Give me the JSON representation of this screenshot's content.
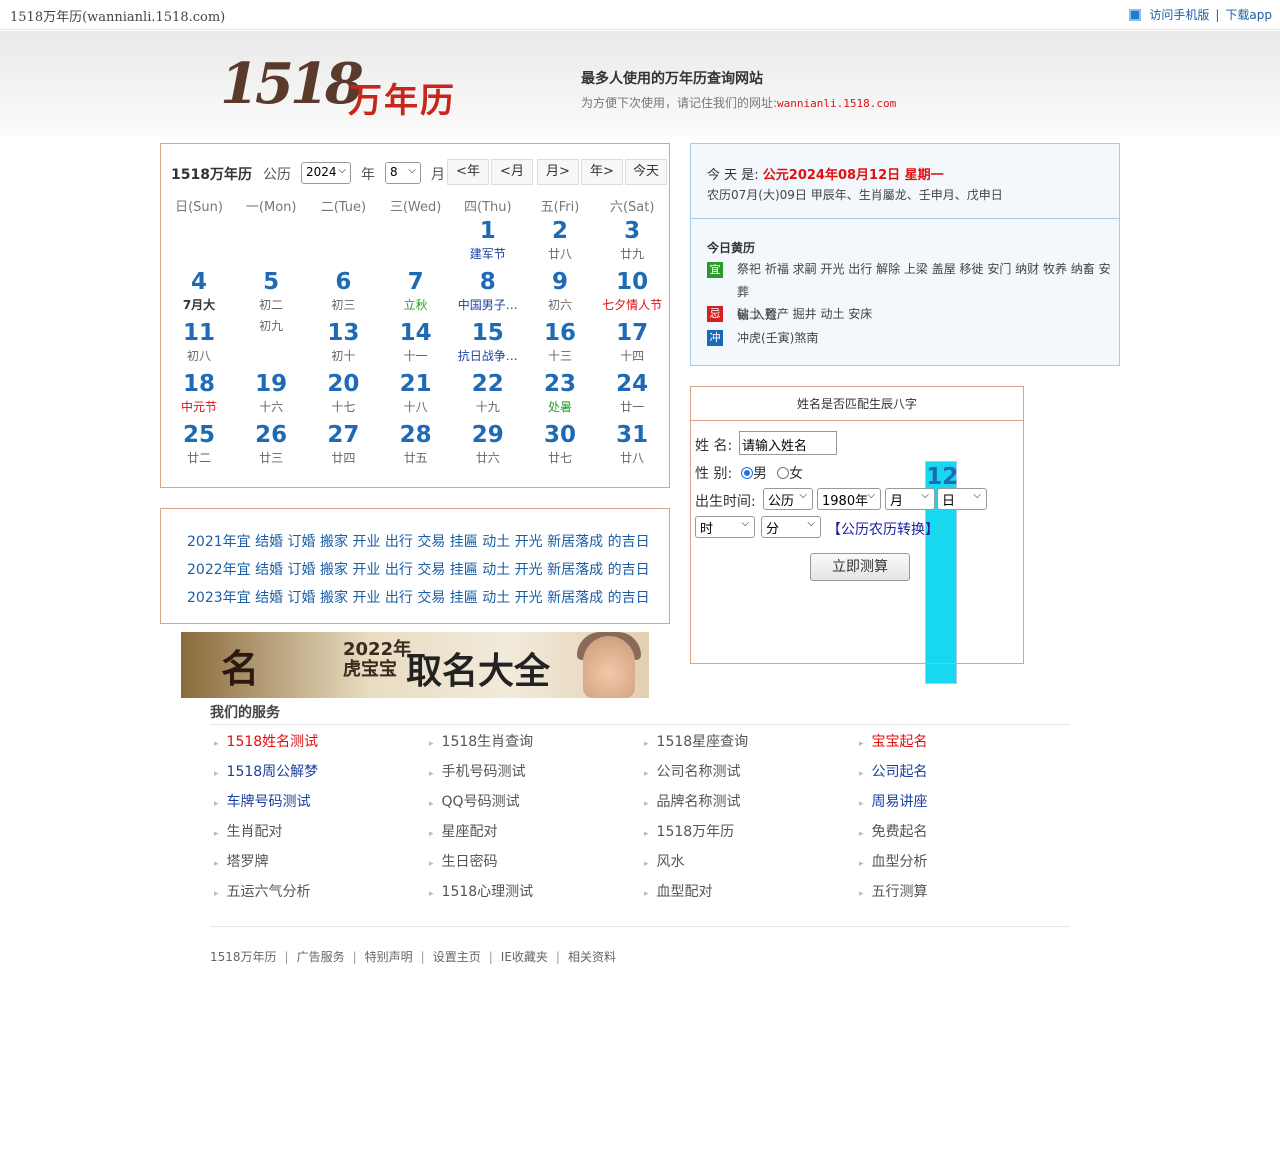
{
  "topbar": {
    "site": "1518万年历(wannianli.1518.com)",
    "mobile": "访问手机版",
    "sep": "|",
    "app": "下载app"
  },
  "header": {
    "logo_num": "1518",
    "logo_cn": "万年历",
    "slogan": "最多人使用的万年历查询网站",
    "tip": "为方便下次使用，请记住我们的网址:",
    "url": "wannianli.1518.com"
  },
  "calendar": {
    "brand": "1518万年历",
    "gongli": "公历",
    "year": "2024",
    "year_unit": "年",
    "month": "8",
    "month_unit": "月",
    "buttons": [
      "<年",
      "<月",
      "月>",
      "年>",
      "今天"
    ],
    "weekdays": [
      "日(Sun)",
      "一(Mon)",
      "二(Tue)",
      "三(Wed)",
      "四(Thu)",
      "五(Fri)",
      "六(Sat)"
    ],
    "days": [
      {
        "d": "1",
        "l": "建军节",
        "c": "blue"
      },
      {
        "d": "2",
        "l": "廿八",
        "c": ""
      },
      {
        "d": "3",
        "l": "廿九",
        "c": ""
      },
      {
        "d": "4",
        "l": "7月大",
        "c": "dark"
      },
      {
        "d": "5",
        "l": "初二",
        "c": ""
      },
      {
        "d": "6",
        "l": "初三",
        "c": ""
      },
      {
        "d": "7",
        "l": "立秋",
        "c": "green"
      },
      {
        "d": "8",
        "l": "中国男子…",
        "c": "blue"
      },
      {
        "d": "9",
        "l": "初六",
        "c": ""
      },
      {
        "d": "10",
        "l": "七夕情人节",
        "c": "red"
      },
      {
        "d": "11",
        "l": "初八",
        "c": ""
      },
      {
        "d": "12",
        "l": "初九",
        "c": "",
        "today": true
      },
      {
        "d": "13",
        "l": "初十",
        "c": ""
      },
      {
        "d": "14",
        "l": "十一",
        "c": ""
      },
      {
        "d": "15",
        "l": "抗日战争…",
        "c": "blue"
      },
      {
        "d": "16",
        "l": "十三",
        "c": ""
      },
      {
        "d": "17",
        "l": "十四",
        "c": ""
      },
      {
        "d": "18",
        "l": "中元节",
        "c": "red"
      },
      {
        "d": "19",
        "l": "十六",
        "c": ""
      },
      {
        "d": "20",
        "l": "十七",
        "c": ""
      },
      {
        "d": "21",
        "l": "十八",
        "c": ""
      },
      {
        "d": "22",
        "l": "十九",
        "c": ""
      },
      {
        "d": "23",
        "l": "处暑",
        "c": "green"
      },
      {
        "d": "24",
        "l": "廿一",
        "c": ""
      },
      {
        "d": "25",
        "l": "廿二",
        "c": ""
      },
      {
        "d": "26",
        "l": "廿三",
        "c": ""
      },
      {
        "d": "27",
        "l": "廿四",
        "c": ""
      },
      {
        "d": "28",
        "l": "廿五",
        "c": ""
      },
      {
        "d": "29",
        "l": "廿六",
        "c": ""
      },
      {
        "d": "30",
        "l": "廿七",
        "c": ""
      },
      {
        "d": "31",
        "l": "廿八",
        "c": ""
      }
    ]
  },
  "years": [
    "2021年宜 结婚 订婚 搬家 开业 出行 交易 挂匾 动土 开光 新居落成 的吉日",
    "2022年宜 结婚 订婚 搬家 开业 出行 交易 挂匾 动土 开光 新居落成 的吉日",
    "2023年宜 结婚 订婚 搬家 开业 出行 交易 挂匾 动土 开光 新居落成 的吉日"
  ],
  "banner": {
    "ming": "名",
    "year": "2022年",
    "sub": "虎宝宝",
    "big": "取名大全"
  },
  "today": {
    "label": "今 天 是: ",
    "date": "公元2024年08月12日 星期一",
    "lunar": "农历07月(大)09日 甲辰年、生肖屬龙、壬申月、戊申日",
    "title": "今日黄历",
    "yi_badge": "宜",
    "yi": "祭祀 祈福 求嗣 开光 出行 解除 上梁 盖屋 移徙 安门 纳财 牧养 纳畜 安葬",
    "yi2": "钻 入殓",
    "ji_badge": "忌",
    "ji": "破土 置产 掘井 动土 安床",
    "chong_badge": "冲",
    "chong": "冲虎(壬寅)煞南"
  },
  "form": {
    "title": "姓名是否匹配生辰八字",
    "name_label": "姓 名:",
    "name_value": "请输入姓名",
    "gender_label": "性 别:",
    "male": "男",
    "female": "女",
    "birth_label": "出生时间:",
    "cal_type": "公历",
    "year": "1980年",
    "month": "月",
    "day": "日",
    "hour": "时",
    "minute": "分",
    "convert": "【公历农历转换】",
    "submit": "立即测算"
  },
  "services": {
    "title": "我们的服务",
    "items": [
      {
        "t": "1518姓名测试",
        "c": "red"
      },
      {
        "t": "1518生肖查询",
        "c": ""
      },
      {
        "t": "1518星座查询",
        "c": ""
      },
      {
        "t": "宝宝起名",
        "c": "red"
      },
      {
        "t": "1518周公解梦",
        "c": "blue"
      },
      {
        "t": "手机号码测试",
        "c": ""
      },
      {
        "t": "公司名称测试",
        "c": ""
      },
      {
        "t": "公司起名",
        "c": "blue"
      },
      {
        "t": "车牌号码测试",
        "c": "blue"
      },
      {
        "t": "QQ号码测试",
        "c": ""
      },
      {
        "t": "品牌名称测试",
        "c": ""
      },
      {
        "t": "周易讲座",
        "c": "blue"
      },
      {
        "t": "生肖配对",
        "c": ""
      },
      {
        "t": "星座配对",
        "c": ""
      },
      {
        "t": "1518万年历",
        "c": ""
      },
      {
        "t": "免费起名",
        "c": ""
      },
      {
        "t": "塔罗牌",
        "c": ""
      },
      {
        "t": "生日密码",
        "c": ""
      },
      {
        "t": "风水",
        "c": ""
      },
      {
        "t": "血型分析",
        "c": ""
      },
      {
        "t": "五运六气分析",
        "c": ""
      },
      {
        "t": "1518心理测试",
        "c": ""
      },
      {
        "t": "血型配对",
        "c": ""
      },
      {
        "t": "五行测算",
        "c": ""
      }
    ]
  },
  "footer": [
    "1518万年历",
    "广告服务",
    "特别声明",
    "设置主页",
    "IE收藏夹",
    "相关资料"
  ],
  "colors": {
    "link": "#1a5ea8",
    "red": "#e01010",
    "day_blue": "#1e6ab4",
    "today_bg": "#18d8f0",
    "border": "#d7a68a"
  }
}
